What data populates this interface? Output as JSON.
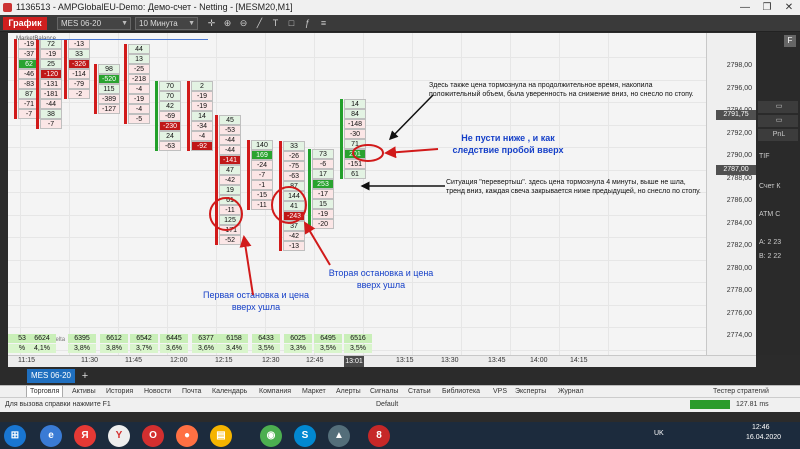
{
  "window": {
    "title": "1136513 - AMPGlobalEU-Demo: Демо-счет - Netting - [MESM20,M1]",
    "controls": [
      "—",
      "❐",
      "✕"
    ]
  },
  "toolbar": {
    "active_tab": "График",
    "symbol": "MES 06-20",
    "timeframe": "10 Минута"
  },
  "chart": {
    "price_labels": [
      "2798,00",
      "2796,00",
      "2794,00",
      "2792,00",
      "2790,00",
      "2788,00",
      "2786,00",
      "2784,00",
      "2782,00",
      "2780,00",
      "2778,00",
      "2776,00",
      "2774,00",
      "2772,00"
    ],
    "last_price": "2791,75",
    "bid_price": "2787,00",
    "time_labels": [
      "11:15",
      "11:30",
      "11:45",
      "12:00",
      "12:15",
      "12:30",
      "12:45",
      "13:01",
      "13:15",
      "13:30",
      "13:45",
      "14:00",
      "14:15"
    ],
    "current_time": "13:01",
    "volumes": [
      "53",
      "6624",
      "6395",
      "6612",
      "6542",
      "6445",
      "6377",
      "6158",
      "6433",
      "6025",
      "6495",
      "6516"
    ],
    "percents": [
      "%",
      "4,1%",
      "3,8%",
      "3,8%",
      "3,7%",
      "3,6%",
      "3,6%",
      "3,4%",
      "3,5%",
      "3,3%",
      "3,5%",
      "3,5%"
    ],
    "watermark": "© 2020 ClusterDelta",
    "market_balance_label": "MarketBalance",
    "columns": [
      {
        "cells": [
          "-19",
          "-37",
          "62",
          "-46",
          "-83",
          "87",
          "-71",
          "-7"
        ]
      },
      {
        "cells": [
          "72",
          "-19",
          "25",
          "-120",
          "-131",
          "-181",
          "-44",
          "38",
          "-7"
        ]
      },
      {
        "cells": [
          "-13",
          "33",
          "-326",
          "-114",
          "-79",
          "-2"
        ]
      },
      {
        "cells": [
          "98",
          "-520",
          "115",
          "-389",
          "-127"
        ]
      },
      {
        "cells": [
          "44",
          "13",
          "-25",
          "-218",
          "-4",
          "-19",
          "-4",
          "-5"
        ]
      },
      {
        "cells": [
          "70",
          "70",
          "42",
          "-69",
          "-230",
          "24",
          "-63"
        ]
      },
      {
        "cells": [
          "2",
          "-19",
          "-19",
          "14",
          "-34",
          "-4",
          "-92"
        ]
      },
      {
        "cells": [
          "45",
          "-53",
          "-44",
          "-44",
          "-141",
          "47",
          "-42",
          "19",
          "61",
          "-11",
          "125",
          "-171",
          "-52"
        ]
      },
      {
        "cells": [
          "140",
          "169",
          "-24",
          "-7",
          "-1",
          "-15",
          "-11"
        ]
      },
      {
        "cells": [
          "33",
          "-26",
          "-75",
          "-63",
          "87",
          "144",
          "41",
          "-243",
          "37",
          "-42",
          "-13"
        ]
      },
      {
        "cells": [
          "73",
          "-6",
          "17",
          "253",
          "-17",
          "15",
          "-19",
          "-20"
        ]
      },
      {
        "cells": [
          "14",
          "84",
          "-148",
          "-30",
          "71",
          "201",
          "-151",
          "61"
        ]
      }
    ]
  },
  "annotations": {
    "top_note": "Здесь также цена тормознула на продолжительное время, накопила положительный объем, была уверенность на снижение вниз, но снесло по стопу.",
    "dont_let_down": "Не пусти ниже , и как следствие пробой вверх",
    "reversal_note": "Ситуация \"перевертыш\". здесь цена тормознула 4 минуты, выше не шла, тренд вниз, каждая свеча закрывается ниже предыдущей, но снесло по стопу.",
    "first_stop": "Первая остановка и цена вверх ушла",
    "second_stop": "Вторая остановка и цена вверх ушла"
  },
  "right_panel": {
    "f_button": "F",
    "pnl": "PnL",
    "tif": "TIF",
    "account": "Счет К",
    "atm": "ATM C",
    "ask": "A: 2 23",
    "bid": "B: 2 22"
  },
  "symbol_tabs": {
    "active": "MES 06-20",
    "add": "+"
  },
  "bottom_tabs": [
    "Торговля",
    "Активы",
    "История",
    "Новости",
    "Почта",
    "Календарь",
    "Компания",
    "Маркет",
    "Алерты",
    "Сигналы",
    "Статьи",
    "Библиотека",
    "VPS",
    "Эксперты",
    "Журнал"
  ],
  "bottom_right_tab": "Тестер стратегий",
  "status": {
    "help": "Для вызова справки нажмите F1",
    "profile": "Default",
    "traffic": "127.81 ms"
  },
  "taskbar": {
    "lang": "UK",
    "time": "12:46",
    "date": "16.04.2020"
  },
  "colors": {
    "accent_red": "#cf1f1f",
    "positive": "#29a32f",
    "negative": "#c01818",
    "annotation_blue": "#1640c8"
  }
}
